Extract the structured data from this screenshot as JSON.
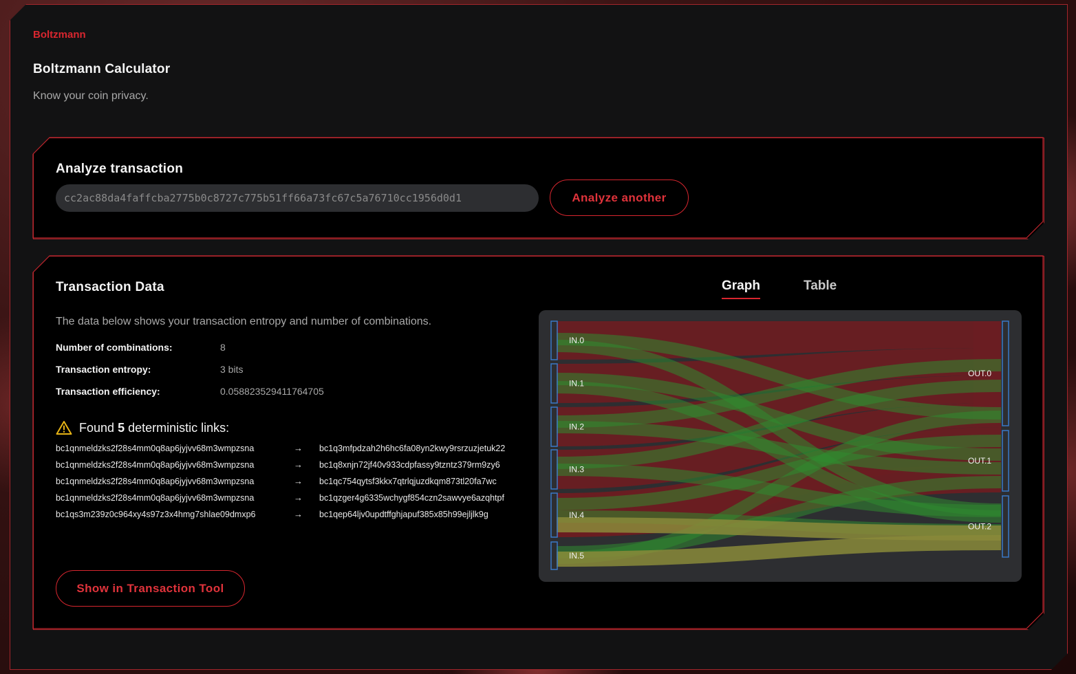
{
  "app": {
    "brand": "Boltzmann",
    "title": "Boltzmann Calculator",
    "subtitle": "Know your coin privacy."
  },
  "analyze": {
    "title": "Analyze transaction",
    "txid": "cc2ac88da4faffcba2775b0c8727c775b51ff66a73fc67c5a76710cc1956d0d1",
    "button_label": "Analyze another"
  },
  "data": {
    "title": "Transaction Data",
    "description": "The data below shows your transaction entropy and number of combinations.",
    "stats": [
      {
        "label": "Number of combinations:",
        "value": "8"
      },
      {
        "label": "Transaction entropy:",
        "value": "3 bits"
      },
      {
        "label": "Transaction efficiency:",
        "value": "0.058823529411764705"
      }
    ],
    "found": {
      "prefix": "Found",
      "count": "5",
      "suffix": "deterministic links:"
    },
    "links": [
      {
        "from": "bc1qnmeldzks2f28s4mm0q8ap6jyjvv68m3wmpzsna",
        "arrow": "→",
        "to": "bc1q3mfpdzah2h6hc6fa08yn2kwy9rsrzuzjetuk22"
      },
      {
        "from": "bc1qnmeldzks2f28s4mm0q8ap6jyjvv68m3wmpzsna",
        "arrow": "→",
        "to": "bc1q8xnjn72jf40v933cdpfassy9tzntz379rm9zy6"
      },
      {
        "from": "bc1qnmeldzks2f28s4mm0q8ap6jyjvv68m3wmpzsna",
        "arrow": "→",
        "to": "bc1qc754qytsf3kkx7qtrlqjuzdkqm873tl20fa7wc"
      },
      {
        "from": "bc1qnmeldzks2f28s4mm0q8ap6jyjvv68m3wmpzsna",
        "arrow": "→",
        "to": "bc1qzger4g6335wchygf854czn2sawvye6azqhtpf"
      },
      {
        "from": "bc1qs3m239z0c964xy4s97z3x4hmg7shlae09dmxp6",
        "arrow": "→",
        "to": "bc1qep64ljv0updtffghjapuf385x85h99ejljlk9g"
      }
    ],
    "tool_button": "Show in Transaction Tool",
    "tabs": {
      "graph": "Graph",
      "table": "Table",
      "active": "graph"
    },
    "graph": {
      "inputs": [
        "IN.0",
        "IN.1",
        "IN.2",
        "IN.3",
        "IN.4",
        "IN.5"
      ],
      "outputs": [
        "OUT.0",
        "OUT.1",
        "OUT.2"
      ],
      "colors": {
        "red": "#6a1d22",
        "green": "#2f8a2f",
        "yellow": "#8a8a3a",
        "node": "#3a78c8",
        "bg": "#2d2e31"
      }
    }
  }
}
